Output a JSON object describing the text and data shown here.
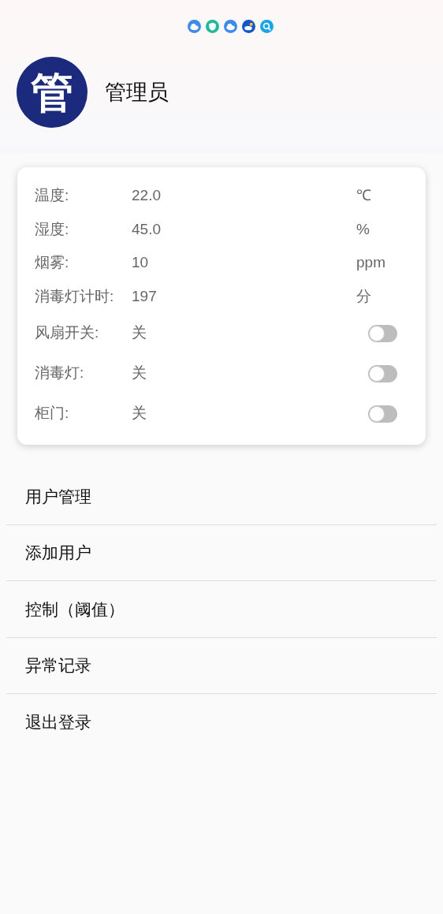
{
  "profile": {
    "avatar_text": "管",
    "name": "管理员"
  },
  "status_card": {
    "rows": [
      {
        "kind": "reading",
        "label": "温度:",
        "value": "22.0",
        "unit": "℃"
      },
      {
        "kind": "reading",
        "label": "湿度:",
        "value": "45.0",
        "unit": "%"
      },
      {
        "kind": "reading",
        "label": "烟雾:",
        "value": "10",
        "unit": "ppm"
      },
      {
        "kind": "reading",
        "label": "消毒灯计时:",
        "value": "197",
        "unit": "分"
      },
      {
        "kind": "toggle",
        "label": "风扇开关:",
        "value": "关",
        "on": false
      },
      {
        "kind": "toggle",
        "label": "消毒灯:",
        "value": "关",
        "on": false
      },
      {
        "kind": "toggle",
        "label": "柜门:",
        "value": "关",
        "on": false
      }
    ]
  },
  "menu": {
    "items": [
      "用户管理",
      "添加用户",
      "控制（阈值）",
      "异常记录",
      "退出登录"
    ]
  }
}
